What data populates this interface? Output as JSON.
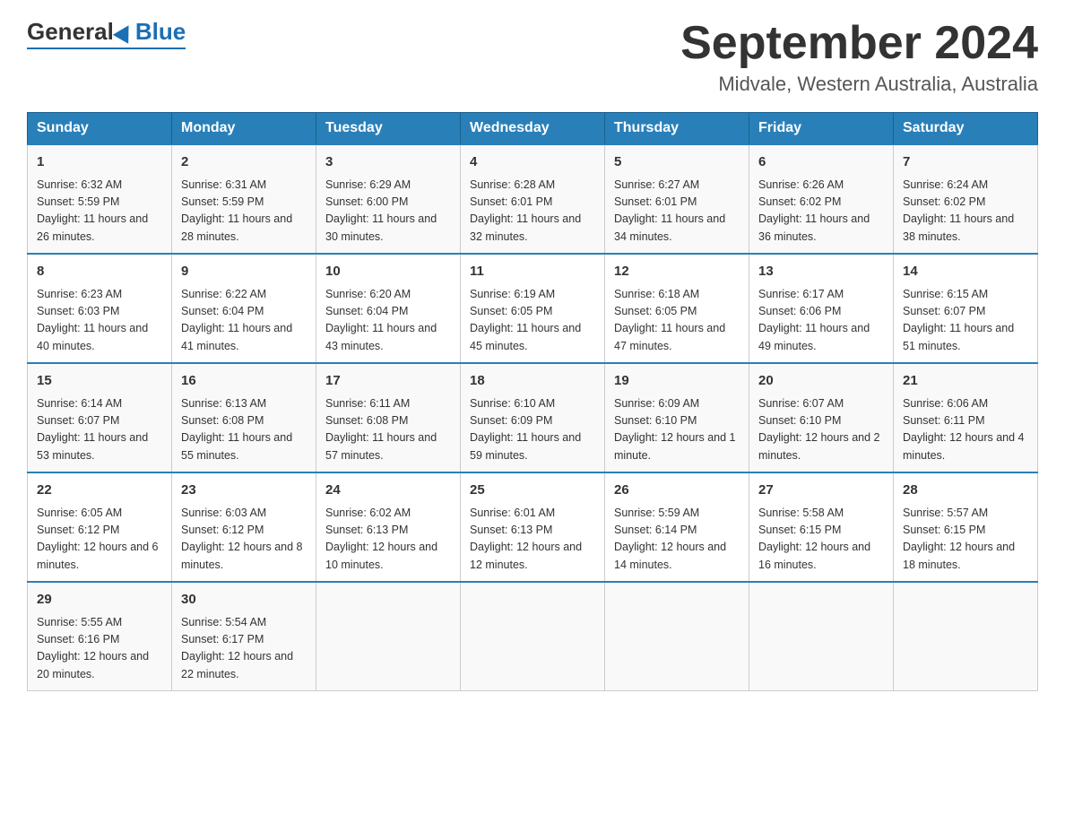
{
  "header": {
    "logo_general": "General",
    "logo_blue": "Blue",
    "month_title": "September 2024",
    "location": "Midvale, Western Australia, Australia"
  },
  "days_of_week": [
    "Sunday",
    "Monday",
    "Tuesday",
    "Wednesday",
    "Thursday",
    "Friday",
    "Saturday"
  ],
  "weeks": [
    [
      {
        "day": "1",
        "sunrise": "6:32 AM",
        "sunset": "5:59 PM",
        "daylight": "11 hours and 26 minutes."
      },
      {
        "day": "2",
        "sunrise": "6:31 AM",
        "sunset": "5:59 PM",
        "daylight": "11 hours and 28 minutes."
      },
      {
        "day": "3",
        "sunrise": "6:29 AM",
        "sunset": "6:00 PM",
        "daylight": "11 hours and 30 minutes."
      },
      {
        "day": "4",
        "sunrise": "6:28 AM",
        "sunset": "6:01 PM",
        "daylight": "11 hours and 32 minutes."
      },
      {
        "day": "5",
        "sunrise": "6:27 AM",
        "sunset": "6:01 PM",
        "daylight": "11 hours and 34 minutes."
      },
      {
        "day": "6",
        "sunrise": "6:26 AM",
        "sunset": "6:02 PM",
        "daylight": "11 hours and 36 minutes."
      },
      {
        "day": "7",
        "sunrise": "6:24 AM",
        "sunset": "6:02 PM",
        "daylight": "11 hours and 38 minutes."
      }
    ],
    [
      {
        "day": "8",
        "sunrise": "6:23 AM",
        "sunset": "6:03 PM",
        "daylight": "11 hours and 40 minutes."
      },
      {
        "day": "9",
        "sunrise": "6:22 AM",
        "sunset": "6:04 PM",
        "daylight": "11 hours and 41 minutes."
      },
      {
        "day": "10",
        "sunrise": "6:20 AM",
        "sunset": "6:04 PM",
        "daylight": "11 hours and 43 minutes."
      },
      {
        "day": "11",
        "sunrise": "6:19 AM",
        "sunset": "6:05 PM",
        "daylight": "11 hours and 45 minutes."
      },
      {
        "day": "12",
        "sunrise": "6:18 AM",
        "sunset": "6:05 PM",
        "daylight": "11 hours and 47 minutes."
      },
      {
        "day": "13",
        "sunrise": "6:17 AM",
        "sunset": "6:06 PM",
        "daylight": "11 hours and 49 minutes."
      },
      {
        "day": "14",
        "sunrise": "6:15 AM",
        "sunset": "6:07 PM",
        "daylight": "11 hours and 51 minutes."
      }
    ],
    [
      {
        "day": "15",
        "sunrise": "6:14 AM",
        "sunset": "6:07 PM",
        "daylight": "11 hours and 53 minutes."
      },
      {
        "day": "16",
        "sunrise": "6:13 AM",
        "sunset": "6:08 PM",
        "daylight": "11 hours and 55 minutes."
      },
      {
        "day": "17",
        "sunrise": "6:11 AM",
        "sunset": "6:08 PM",
        "daylight": "11 hours and 57 minutes."
      },
      {
        "day": "18",
        "sunrise": "6:10 AM",
        "sunset": "6:09 PM",
        "daylight": "11 hours and 59 minutes."
      },
      {
        "day": "19",
        "sunrise": "6:09 AM",
        "sunset": "6:10 PM",
        "daylight": "12 hours and 1 minute."
      },
      {
        "day": "20",
        "sunrise": "6:07 AM",
        "sunset": "6:10 PM",
        "daylight": "12 hours and 2 minutes."
      },
      {
        "day": "21",
        "sunrise": "6:06 AM",
        "sunset": "6:11 PM",
        "daylight": "12 hours and 4 minutes."
      }
    ],
    [
      {
        "day": "22",
        "sunrise": "6:05 AM",
        "sunset": "6:12 PM",
        "daylight": "12 hours and 6 minutes."
      },
      {
        "day": "23",
        "sunrise": "6:03 AM",
        "sunset": "6:12 PM",
        "daylight": "12 hours and 8 minutes."
      },
      {
        "day": "24",
        "sunrise": "6:02 AM",
        "sunset": "6:13 PM",
        "daylight": "12 hours and 10 minutes."
      },
      {
        "day": "25",
        "sunrise": "6:01 AM",
        "sunset": "6:13 PM",
        "daylight": "12 hours and 12 minutes."
      },
      {
        "day": "26",
        "sunrise": "5:59 AM",
        "sunset": "6:14 PM",
        "daylight": "12 hours and 14 minutes."
      },
      {
        "day": "27",
        "sunrise": "5:58 AM",
        "sunset": "6:15 PM",
        "daylight": "12 hours and 16 minutes."
      },
      {
        "day": "28",
        "sunrise": "5:57 AM",
        "sunset": "6:15 PM",
        "daylight": "12 hours and 18 minutes."
      }
    ],
    [
      {
        "day": "29",
        "sunrise": "5:55 AM",
        "sunset": "6:16 PM",
        "daylight": "12 hours and 20 minutes."
      },
      {
        "day": "30",
        "sunrise": "5:54 AM",
        "sunset": "6:17 PM",
        "daylight": "12 hours and 22 minutes."
      },
      null,
      null,
      null,
      null,
      null
    ]
  ],
  "labels": {
    "sunrise_prefix": "Sunrise: ",
    "sunset_prefix": "Sunset: ",
    "daylight_prefix": "Daylight: "
  }
}
